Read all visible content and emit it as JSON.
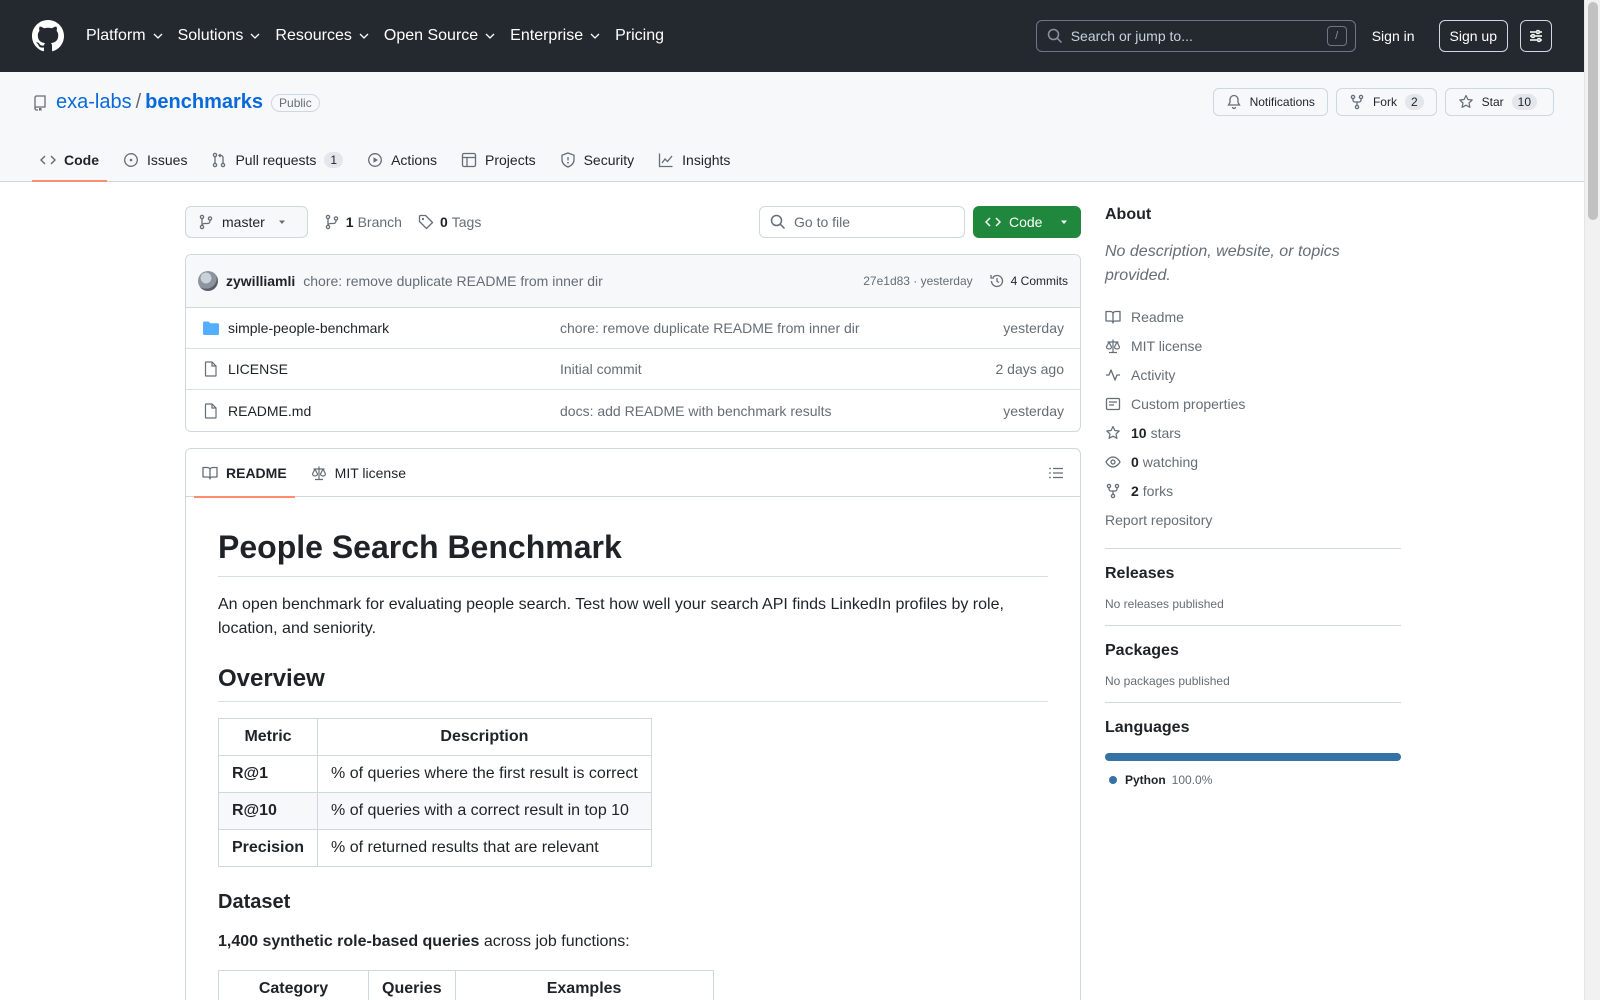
{
  "header": {
    "nav": [
      {
        "label": "Platform",
        "has_menu": true
      },
      {
        "label": "Solutions",
        "has_menu": true
      },
      {
        "label": "Resources",
        "has_menu": true
      },
      {
        "label": "Open Source",
        "has_menu": true
      },
      {
        "label": "Enterprise",
        "has_menu": true
      },
      {
        "label": "Pricing",
        "has_menu": false
      }
    ],
    "search_placeholder": "Search or jump to...",
    "search_key": "/",
    "sign_in": "Sign in",
    "sign_up": "Sign up"
  },
  "repo": {
    "owner": "exa-labs",
    "separator": "/",
    "name": "benchmarks",
    "visibility": "Public",
    "notifications_label": "Notifications",
    "fork_label": "Fork",
    "fork_count": "2",
    "star_label": "Star",
    "star_count": "10",
    "tabs": [
      {
        "label": "Code",
        "icon": "code-icon",
        "active": true
      },
      {
        "label": "Issues",
        "icon": "issue-icon"
      },
      {
        "label": "Pull requests",
        "icon": "pull-request-icon",
        "count": "1"
      },
      {
        "label": "Actions",
        "icon": "play-icon"
      },
      {
        "label": "Projects",
        "icon": "table-icon"
      },
      {
        "label": "Security",
        "icon": "shield-icon"
      },
      {
        "label": "Insights",
        "icon": "graph-icon"
      }
    ]
  },
  "toolbar": {
    "branch": "master",
    "branches_count": "1",
    "branches_label": "Branch",
    "tags_count": "0",
    "tags_label": "Tags",
    "goto_placeholder": "Go to file",
    "code_button": "Code"
  },
  "commit": {
    "author": "zywilliamli",
    "message": "chore: remove duplicate README from inner dir",
    "hash_time": "27e1d83 · yesterday",
    "commits_label": "4 Commits"
  },
  "files": [
    {
      "type": "folder",
      "name": "simple-people-benchmark",
      "message": "chore: remove duplicate README from inner dir",
      "date": "yesterday"
    },
    {
      "type": "file",
      "name": "LICENSE",
      "message": "Initial commit",
      "date": "2 days ago"
    },
    {
      "type": "file",
      "name": "README.md",
      "message": "docs: add README with benchmark results",
      "date": "yesterday"
    }
  ],
  "readme": {
    "tabs": [
      {
        "label": "README",
        "icon": "book-icon",
        "active": true
      },
      {
        "label": "MIT license",
        "icon": "law-icon"
      }
    ],
    "title": "People Search Benchmark",
    "intro": "An open benchmark for evaluating people search. Test how well your search API finds LinkedIn profiles by role, location, and seniority.",
    "overview_heading": "Overview",
    "metrics_table": {
      "headers": [
        "Metric",
        "Description"
      ],
      "rows": [
        [
          "R@1",
          "% of queries where the first result is correct"
        ],
        [
          "R@10",
          "% of queries with a correct result in top 10"
        ],
        [
          "Precision",
          "% of returned results that are relevant"
        ]
      ]
    },
    "dataset_heading": "Dataset",
    "dataset_bold": "1,400 synthetic role-based queries",
    "dataset_rest": " across job functions:",
    "dataset_table_headers": [
      "Category",
      "Queries",
      "Examples"
    ]
  },
  "sidebar": {
    "about_heading": "About",
    "about_desc": "No description, website, or topics provided.",
    "links": [
      {
        "icon": "book-icon",
        "label": "Readme"
      },
      {
        "icon": "law-icon",
        "label": "MIT license"
      },
      {
        "icon": "pulse-icon",
        "label": "Activity"
      },
      {
        "icon": "note-icon",
        "label": "Custom properties"
      }
    ],
    "stars_count": "10",
    "stars_label": "stars",
    "watching_count": "0",
    "watching_label": "watching",
    "forks_count": "2",
    "forks_label": "forks",
    "report": "Report repository",
    "releases_heading": "Releases",
    "releases_text": "No releases published",
    "packages_heading": "Packages",
    "packages_text": "No packages published",
    "languages_heading": "Languages",
    "language_name": "Python",
    "language_pct": "100.0%",
    "language_color": "#3572a5"
  }
}
